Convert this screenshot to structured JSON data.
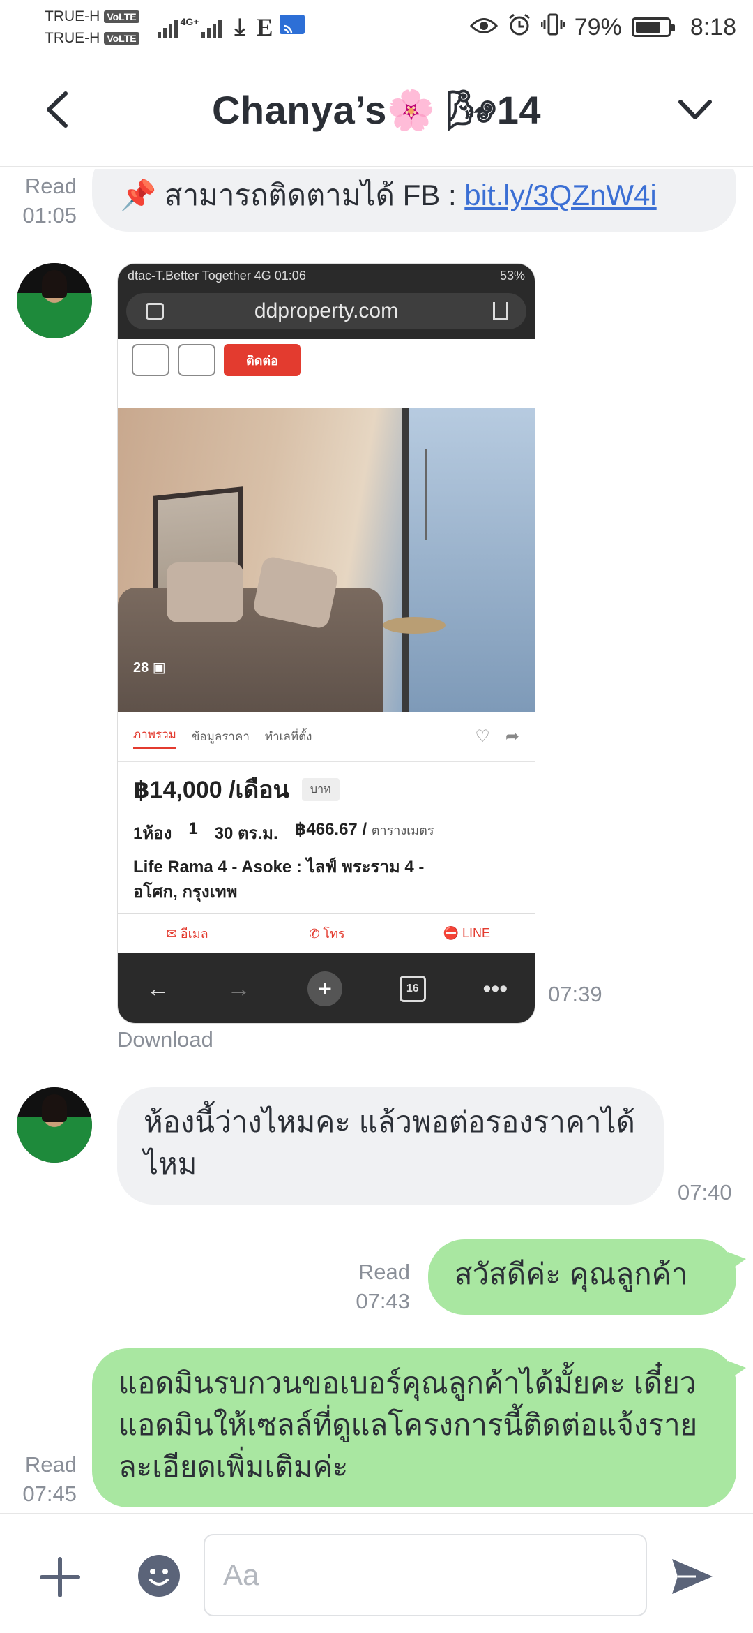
{
  "status_bar": {
    "carrier_1": "TRUE-H",
    "carrier_2": "TRUE-H",
    "volte_label": "VoLTE",
    "network_label": "4G+",
    "data_label": "E",
    "icons": [
      "signal-icon",
      "download-icon",
      "cast-icon",
      "eye-icon",
      "alarm-icon",
      "vibrate-icon",
      "battery-icon"
    ],
    "battery_percent": "79%",
    "battery_level": 0.79,
    "time": "8:18"
  },
  "header": {
    "title": "Chanya’s🌸 🌬14",
    "back_icon": "back-arrow-icon",
    "menu_icon": "chevron-down-icon"
  },
  "messages": [
    {
      "direction": "out",
      "status": "Read",
      "time": "01:05",
      "text_prefix": "📌 สามารถติดตามได้ FB : ",
      "link": "bit.ly/3QZnW4i"
    },
    {
      "direction": "in",
      "type": "image",
      "time": "07:39",
      "download_label": "Download",
      "screenshot": {
        "status_left": "dtac-T.Better Together  4G  01:06",
        "status_right": "53%",
        "url": "ddproperty.com",
        "red_button": "ติดต่อ",
        "photo_count": "28",
        "tabs": [
          "ภาพรวม",
          "ข้อมูลราคา",
          "ทำเลที่ตั้ง"
        ],
        "price": "฿14,000 /เดือน",
        "price_tag": "บาท",
        "specs": {
          "bed": "1ห้อง",
          "bath": "1",
          "area": "30 ตร.ม.",
          "price_per_sqm": "฿466.67 /",
          "price_per_sqm_unit": "ตารางเมตร"
        },
        "project_line_1": "Life Rama 4 - Asoke : ไลฟ์ พระราม 4 -",
        "project_line_2": "อโศก, กรุงเทพ",
        "actions": [
          "✉ อีเมล",
          "✆ โทร",
          "⛔ LINE"
        ],
        "nav_tab_count": "16"
      }
    },
    {
      "direction": "in",
      "time": "07:40",
      "text": "ห้องนี้ว่างไหมคะ แล้วพอต่อรองราคาได้ไหม"
    },
    {
      "direction": "out",
      "status": "Read",
      "time": "07:43",
      "text": "สวัสดีค่ะ คุณลูกค้า"
    },
    {
      "direction": "out",
      "status": "Read",
      "time": "07:45",
      "text": "แอดมินรบกวนขอเบอร์คุณลูกค้าได้มั้ยคะ เดี๋ยวแอดมินให้เซลล์ที่ดูแลโครงการนี้ติดต่อแจ้งรายละเอียดเพิ่มเติมค่ะ"
    }
  ],
  "input_bar": {
    "placeholder": "Aa",
    "value": ""
  },
  "colors": {
    "outgoing_bubble": "#a9e7a1",
    "incoming_bubble": "#f0f1f3",
    "link": "#3b6fd4",
    "accent_icons": "#5b6479"
  }
}
